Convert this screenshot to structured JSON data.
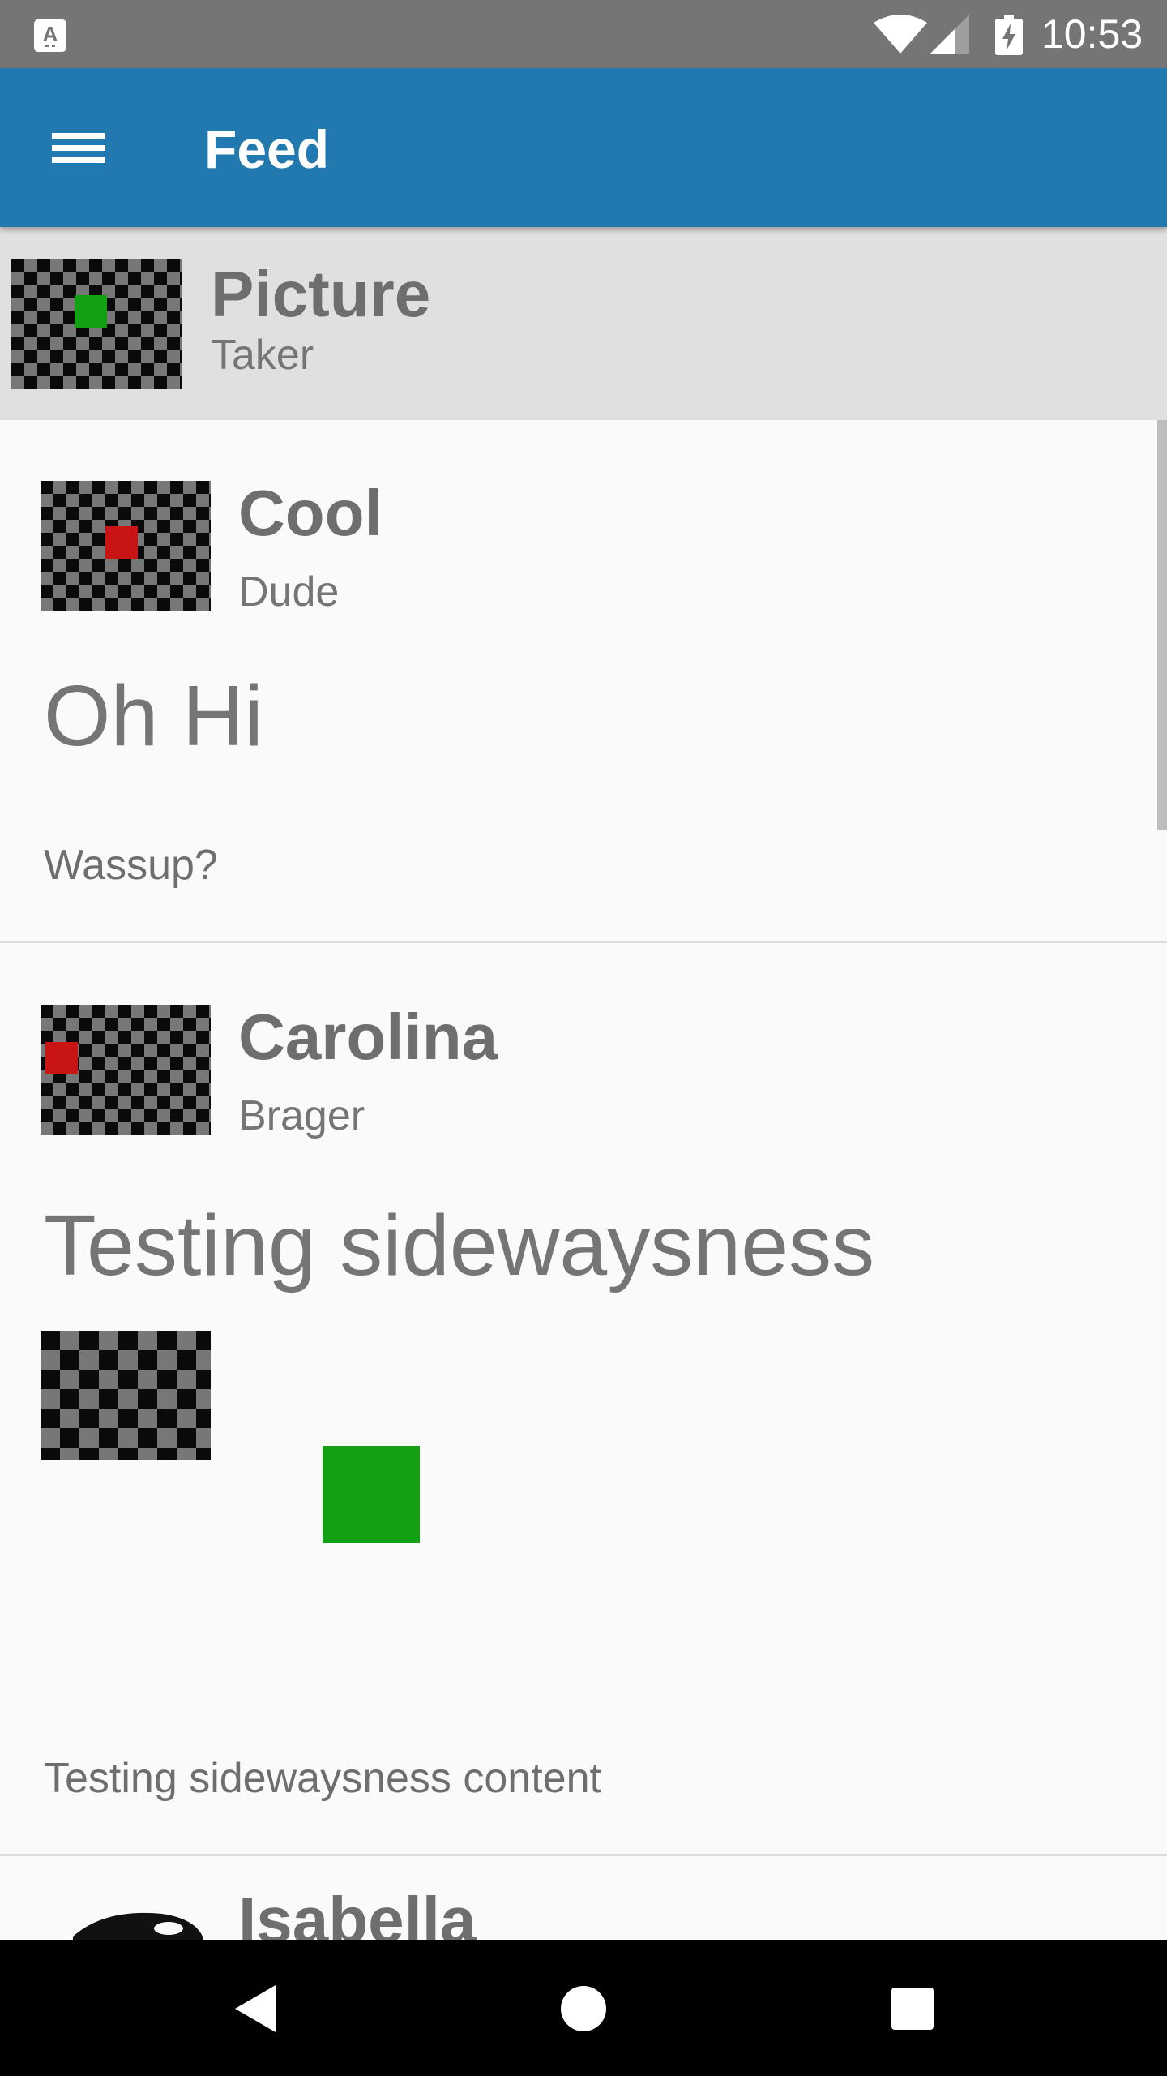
{
  "status_bar": {
    "time": "10:53",
    "notification_icon": "keyboard-a-icon",
    "notification_letter": "A"
  },
  "app_bar": {
    "title": "Feed",
    "menu_icon": "hamburger-menu-icon"
  },
  "picture_row": {
    "name": "Picture",
    "subname": "Taker",
    "accent": "#14a014"
  },
  "posts": [
    {
      "name": "Cool",
      "subname": "Dude",
      "title": "Oh Hi",
      "body": "Wassup?",
      "accent": "#c81414"
    },
    {
      "name": "Carolina",
      "subname": "Brager",
      "title": "Testing sidewaysness",
      "body": "Testing sidewaysness content",
      "accent": "#c81414",
      "image_accent": "#14a014"
    },
    {
      "name": "Isabella",
      "icon": "orca-icon"
    }
  ],
  "nav": {
    "back": "back-icon",
    "home": "home-icon",
    "recents": "recents-icon"
  },
  "colors": {
    "app_bar": "#2179b0",
    "status_bar": "#757575",
    "picture_row": "#e0e0e0",
    "background": "#fafafa"
  }
}
